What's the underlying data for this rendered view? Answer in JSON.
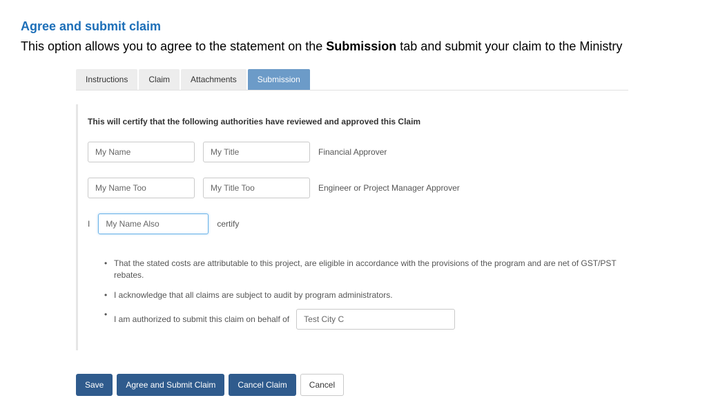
{
  "heading": "Agree and submit claim",
  "subheading_pre": "This option allows you to agree to the statement on the ",
  "subheading_bold": "Submission",
  "subheading_post": " tab and submit your claim to the Ministry",
  "tabs": {
    "instructions": "Instructions",
    "claim": "Claim",
    "attachments": "Attachments",
    "submission": "Submission"
  },
  "certify_intro": "This will certify that the following authorities have reviewed and approved this Claim",
  "approver1": {
    "name": "My Name",
    "title": "My Title",
    "role": "Financial Approver"
  },
  "approver2": {
    "name": "My Name Too",
    "title": "My Title Too",
    "role": "Engineer or Project Manager Approver"
  },
  "certify_row": {
    "prefix": "I",
    "name": "My Name Also",
    "suffix": "certify"
  },
  "bullets": {
    "b1": "That the stated costs are attributable to this project, are eligible in accordance with the provisions of the program and are net of GST/PST rebates.",
    "b2": "I acknowledge that all claims are subject to audit by program administrators.",
    "b3_label": "I am authorized to submit this claim on behalf of",
    "b3_value": "Test City C"
  },
  "buttons": {
    "save": "Save",
    "agree": "Agree and Submit Claim",
    "cancel_claim": "Cancel Claim",
    "cancel": "Cancel"
  }
}
